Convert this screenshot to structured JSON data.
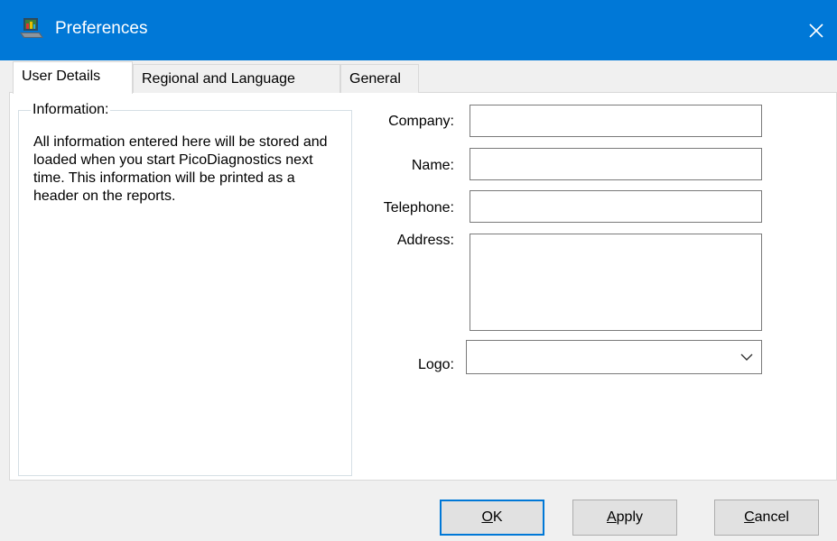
{
  "window": {
    "title": "Preferences",
    "accent": "#0078d7"
  },
  "tabs": [
    {
      "label": "User Details",
      "active": true
    },
    {
      "label": "Regional and Language",
      "active": false
    },
    {
      "label": "General",
      "active": false
    }
  ],
  "info_group": {
    "legend": "Information:",
    "text": "All information entered here will be stored and loaded when you start PicoDiagnostics next time. This information will be printed as a header on the reports."
  },
  "form": {
    "company_label": "Company:",
    "company_value": "",
    "name_label": "Name:",
    "name_value": "",
    "telephone_label": "Telephone:",
    "telephone_value": "",
    "address_label": "Address:",
    "address_value": "",
    "logo_label": "Logo:",
    "logo_value": ""
  },
  "buttons": {
    "ok_mnemonic": "O",
    "ok_rest": "K",
    "apply_mnemonic": "A",
    "apply_rest": "pply",
    "cancel_mnemonic": "C",
    "cancel_rest": "ancel"
  },
  "icons": {
    "app": "laptop-chart-icon",
    "close": "close-icon",
    "dropdown": "chevron-down-icon"
  }
}
